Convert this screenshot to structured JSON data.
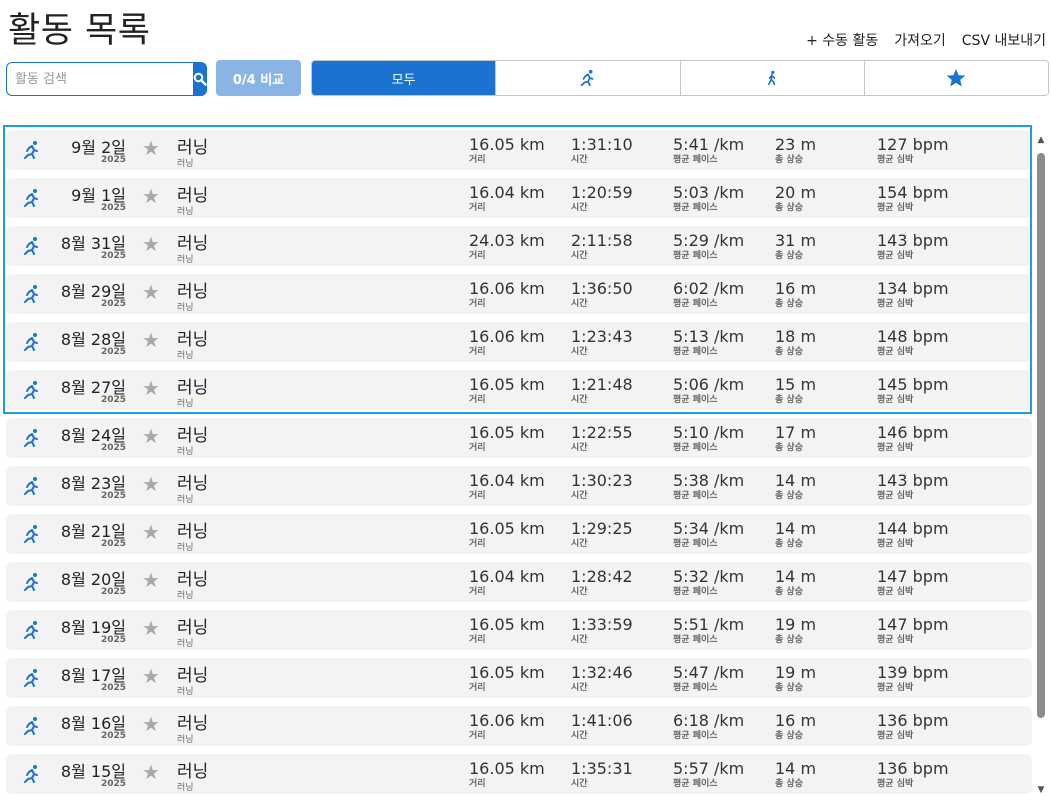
{
  "header": {
    "title": "활동 목록",
    "actions": [
      "+ 수동 활동",
      "가져오기",
      "CSV 내보내기"
    ]
  },
  "search": {
    "placeholder": "활동 검색",
    "value": ""
  },
  "compare": {
    "label": "0/4 비교"
  },
  "filters": {
    "all_label": "모두",
    "icons": [
      "running-icon",
      "walking-icon",
      "star-icon"
    ]
  },
  "colors": {
    "accent": "#1a73d0",
    "selection": "#1aa0e0",
    "row_bg": "#f3f3f3"
  },
  "metric_labels": {
    "distance": "거리",
    "time": "시간",
    "pace": "평균 페이스",
    "elevation": "총 상승",
    "heart_rate": "평균 심박"
  },
  "activities": [
    {
      "date": "9월 2일",
      "year": "2025",
      "name": "러닝",
      "sub": "러닝",
      "distance": "16.05 km",
      "time": "1:31:10",
      "pace": "5:41 /km",
      "elevation": "23 m",
      "heart_rate": "127 bpm",
      "selected": true
    },
    {
      "date": "9월 1일",
      "year": "2025",
      "name": "러닝",
      "sub": "러닝",
      "distance": "16.04 km",
      "time": "1:20:59",
      "pace": "5:03 /km",
      "elevation": "20 m",
      "heart_rate": "154 bpm",
      "selected": true
    },
    {
      "date": "8월 31일",
      "year": "2025",
      "name": "러닝",
      "sub": "러닝",
      "distance": "24.03 km",
      "time": "2:11:58",
      "pace": "5:29 /km",
      "elevation": "31 m",
      "heart_rate": "143 bpm",
      "selected": true
    },
    {
      "date": "8월 29일",
      "year": "2025",
      "name": "러닝",
      "sub": "러닝",
      "distance": "16.06 km",
      "time": "1:36:50",
      "pace": "6:02 /km",
      "elevation": "16 m",
      "heart_rate": "134 bpm",
      "selected": true
    },
    {
      "date": "8월 28일",
      "year": "2025",
      "name": "러닝",
      "sub": "러닝",
      "distance": "16.06 km",
      "time": "1:23:43",
      "pace": "5:13 /km",
      "elevation": "18 m",
      "heart_rate": "148 bpm",
      "selected": true
    },
    {
      "date": "8월 27일",
      "year": "2025",
      "name": "러닝",
      "sub": "러닝",
      "distance": "16.05 km",
      "time": "1:21:48",
      "pace": "5:06 /km",
      "elevation": "15 m",
      "heart_rate": "145 bpm",
      "selected": true
    },
    {
      "date": "8월 24일",
      "year": "2025",
      "name": "러닝",
      "sub": "러닝",
      "distance": "16.05 km",
      "time": "1:22:55",
      "pace": "5:10 /km",
      "elevation": "17 m",
      "heart_rate": "146 bpm",
      "selected": false
    },
    {
      "date": "8월 23일",
      "year": "2025",
      "name": "러닝",
      "sub": "러닝",
      "distance": "16.04 km",
      "time": "1:30:23",
      "pace": "5:38 /km",
      "elevation": "14 m",
      "heart_rate": "143 bpm",
      "selected": false
    },
    {
      "date": "8월 21일",
      "year": "2025",
      "name": "러닝",
      "sub": "러닝",
      "distance": "16.05 km",
      "time": "1:29:25",
      "pace": "5:34 /km",
      "elevation": "14 m",
      "heart_rate": "144 bpm",
      "selected": false
    },
    {
      "date": "8월 20일",
      "year": "2025",
      "name": "러닝",
      "sub": "러닝",
      "distance": "16.04 km",
      "time": "1:28:42",
      "pace": "5:32 /km",
      "elevation": "14 m",
      "heart_rate": "147 bpm",
      "selected": false
    },
    {
      "date": "8월 19일",
      "year": "2025",
      "name": "러닝",
      "sub": "러닝",
      "distance": "16.05 km",
      "time": "1:33:59",
      "pace": "5:51 /km",
      "elevation": "19 m",
      "heart_rate": "147 bpm",
      "selected": false
    },
    {
      "date": "8월 17일",
      "year": "2025",
      "name": "러닝",
      "sub": "러닝",
      "distance": "16.05 km",
      "time": "1:32:46",
      "pace": "5:47 /km",
      "elevation": "19 m",
      "heart_rate": "139 bpm",
      "selected": false
    },
    {
      "date": "8월 16일",
      "year": "2025",
      "name": "러닝",
      "sub": "러닝",
      "distance": "16.06 km",
      "time": "1:41:06",
      "pace": "6:18 /km",
      "elevation": "16 m",
      "heart_rate": "136 bpm",
      "selected": false
    },
    {
      "date": "8월 15일",
      "year": "2025",
      "name": "러닝",
      "sub": "러닝",
      "distance": "16.05 km",
      "time": "1:35:31",
      "pace": "5:57 /km",
      "elevation": "14 m",
      "heart_rate": "136 bpm",
      "selected": false
    }
  ]
}
